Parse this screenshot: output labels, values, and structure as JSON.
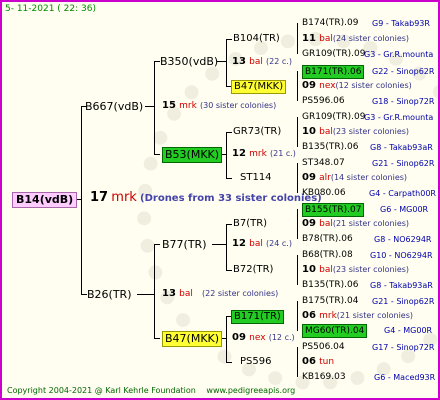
{
  "header": {
    "date": "5- 11-2021 ( 22: 36)"
  },
  "footer": {
    "copyright": "Copyright 2004-2021 @ Karl Kehrle Foundation",
    "site": "www.pedigreeapis.org"
  },
  "root": {
    "name": "B14(vdB)",
    "gen_number": "17",
    "gen_mark": "mrk",
    "note": "(Drones from 33 sister colonies)"
  },
  "gen1": [
    {
      "name": "B667(vdB)",
      "gen_number": "15",
      "gen_mark": "mrk",
      "count": "(30 sister colonies)"
    },
    {
      "name": "B26(TR)",
      "gen_number": "13",
      "gen_mark": "bal",
      "count": "(22 sister colonies)"
    }
  ],
  "gen2": [
    {
      "name": "B350(vdB)",
      "gen_number": "13",
      "gen_mark": "bal",
      "count": "(22 c.)"
    },
    {
      "name": "B53(MKK)",
      "gen_number": "12",
      "gen_mark": "mrk",
      "count": "(21 c.)"
    },
    {
      "name": "B77(TR)",
      "gen_number": "12",
      "gen_mark": "bal",
      "count": "(24 c.)"
    },
    {
      "name": "B47(MKK)",
      "gen_number": "09",
      "gen_mark": "nex",
      "count": "(12 c.)"
    }
  ],
  "gen3": [
    {
      "name": "B104(TR)",
      "gen_number": "11",
      "gen_mark": "bal",
      "count": "(24 sister colonies)"
    },
    {
      "name": "B47(MKK)",
      "gen_number": "09",
      "gen_mark": "nex",
      "count": "(12 sister colonies)"
    },
    {
      "name": "GR73(TR)",
      "gen_number": "10",
      "gen_mark": "bal",
      "count": "(23 sister colonies)"
    },
    {
      "name": "ST114",
      "gen_number": "09",
      "gen_mark": "alr",
      "count": "(14 sister colonies)"
    },
    {
      "name": "B7(TR)",
      "gen_number": "09",
      "gen_mark": "bal",
      "count": "(21 sister colonies)"
    },
    {
      "name": "B72(TR)",
      "gen_number": "10",
      "gen_mark": "bal",
      "count": "(23 sister colonies)"
    },
    {
      "name": "B171(TR)",
      "gen_number": "06",
      "gen_mark": "mrk",
      "count": "(21 sister colonies)"
    },
    {
      "name": "PS596",
      "gen_number": "06",
      "gen_mark": "tun",
      "count": ""
    }
  ],
  "gen4": [
    {
      "name": "B174(TR).09",
      "ref": "G9 - Takab93R"
    },
    {
      "name": "GR109(TR).09",
      "ref": "G3 - Gr.R.mounta"
    },
    {
      "name": "B171(TR).06",
      "ref": "G22 - Sinop62R"
    },
    {
      "name": "PS596.06",
      "ref": "G18 - Sinop72R"
    },
    {
      "name": "GR109(TR).09",
      "ref": "G3 - Gr.R.mounta"
    },
    {
      "name": "B135(TR).06",
      "ref": "G8 - Takab93aR"
    },
    {
      "name": "ST348.07",
      "ref": "G21 - Sinop62R"
    },
    {
      "name": "KB080.06",
      "ref": "G4 - Carpath00R"
    },
    {
      "name": "B155(TR).07",
      "ref": "G6 - MG00R"
    },
    {
      "name": "B78(TR).06",
      "ref": "G8 - NO6294R"
    },
    {
      "name": "B68(TR).08",
      "ref": "G10 - NO6294R"
    },
    {
      "name": "B135(TR).06",
      "ref": "G8 - Takab93aR"
    },
    {
      "name": "B175(TR).04",
      "ref": "G21 - Sinop62R"
    },
    {
      "name": "MG60(TR).04",
      "ref": "G4 - MG00R"
    },
    {
      "name": "PS506.04",
      "ref": "G17 - Sinop72R"
    },
    {
      "name": "KB169.03",
      "ref": "G6 - Maced93R"
    }
  ]
}
